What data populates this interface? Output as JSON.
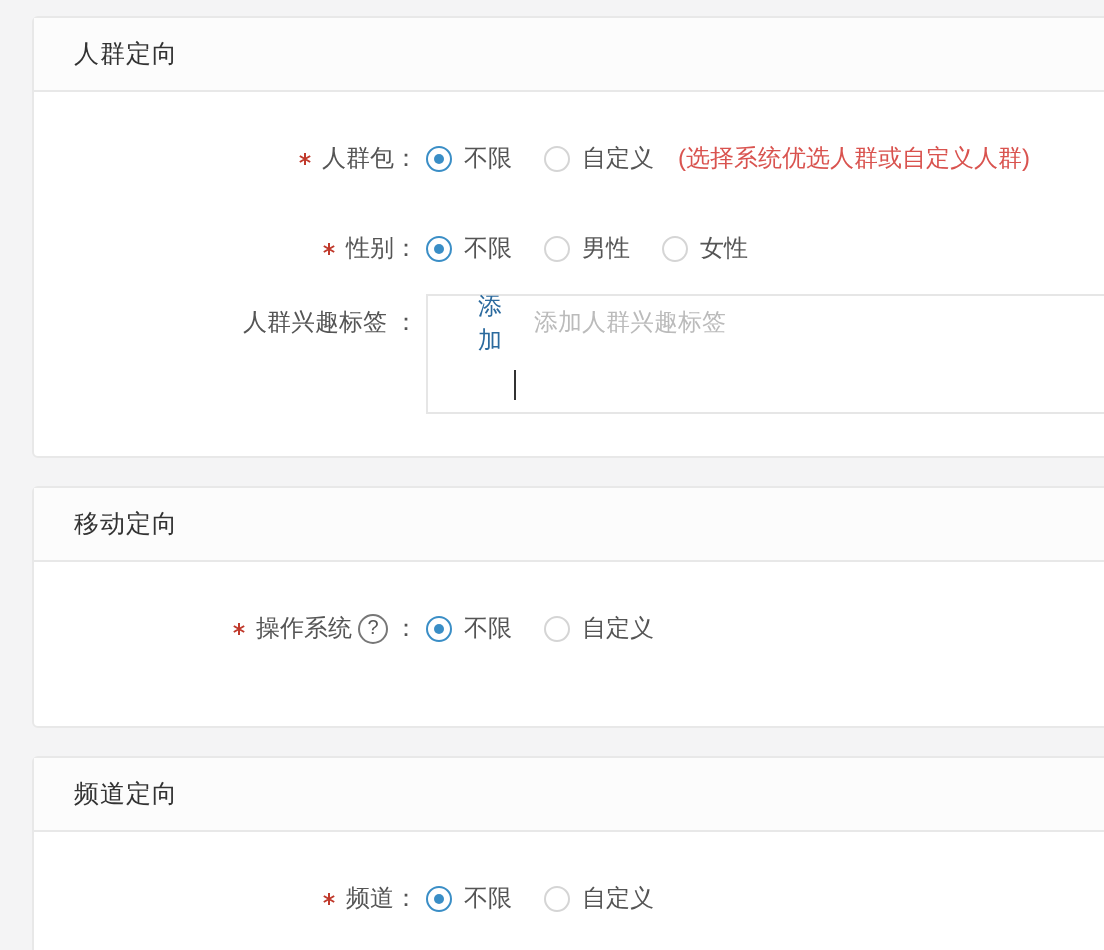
{
  "sections": [
    {
      "title": "人群定向",
      "fields": [
        {
          "kind": "radio",
          "required": true,
          "label": "人群包：",
          "options": [
            {
              "label": "不限",
              "selected": true
            },
            {
              "label": "自定义",
              "selected": false
            }
          ],
          "hint": "(选择系统优选人群或自定义人群)"
        },
        {
          "kind": "radio",
          "required": true,
          "label": "性别：",
          "options": [
            {
              "label": "不限",
              "selected": true
            },
            {
              "label": "男性",
              "selected": false
            },
            {
              "label": "女性",
              "selected": false
            }
          ]
        },
        {
          "kind": "tags",
          "label": "人群兴趣标签 ：",
          "button": "添加",
          "placeholder": "添加人群兴趣标签"
        }
      ]
    },
    {
      "title": "移动定向",
      "fields": [
        {
          "kind": "radio",
          "required": true,
          "label": "操作系统",
          "help": "?",
          "label_end": "：",
          "options": [
            {
              "label": "不限",
              "selected": true
            },
            {
              "label": "自定义",
              "selected": false
            }
          ]
        }
      ]
    },
    {
      "title": "频道定向",
      "fields": [
        {
          "kind": "radio",
          "required": true,
          "label": "频道：",
          "options": [
            {
              "label": "不限",
              "selected": true
            },
            {
              "label": "自定义",
              "selected": false
            }
          ]
        }
      ]
    }
  ]
}
